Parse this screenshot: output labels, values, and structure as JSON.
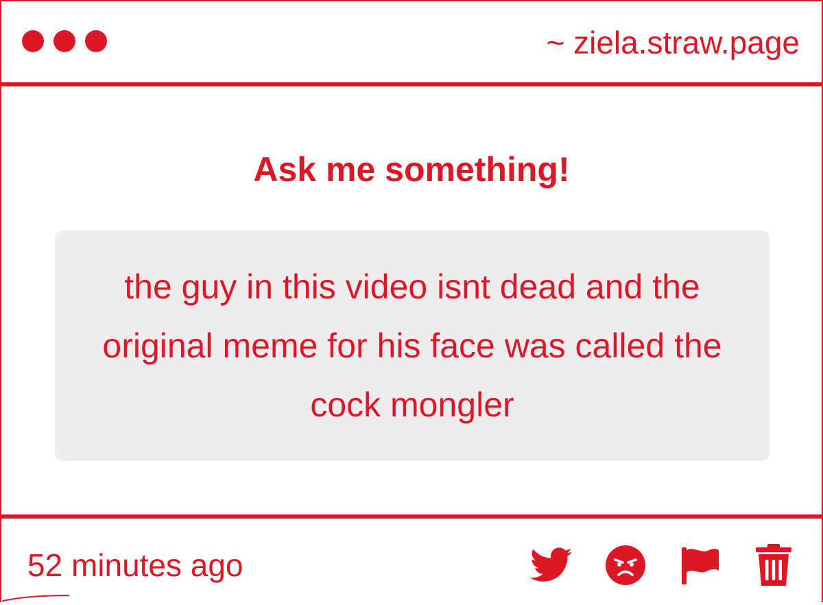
{
  "window": {
    "url": "~ ziela.straw.page"
  },
  "main": {
    "heading": "Ask me something!",
    "question": "the guy in this video isnt dead and the original meme for his face was called the cock mongler"
  },
  "footer": {
    "timestamp": "52 minutes ago",
    "actions": [
      {
        "icon": "twitter-icon"
      },
      {
        "icon": "angry-face-icon"
      },
      {
        "icon": "flag-icon"
      },
      {
        "icon": "trash-icon"
      }
    ]
  },
  "colors": {
    "accent": "#dc1726",
    "question_bg": "#eeecee",
    "background": "#ffffff"
  }
}
